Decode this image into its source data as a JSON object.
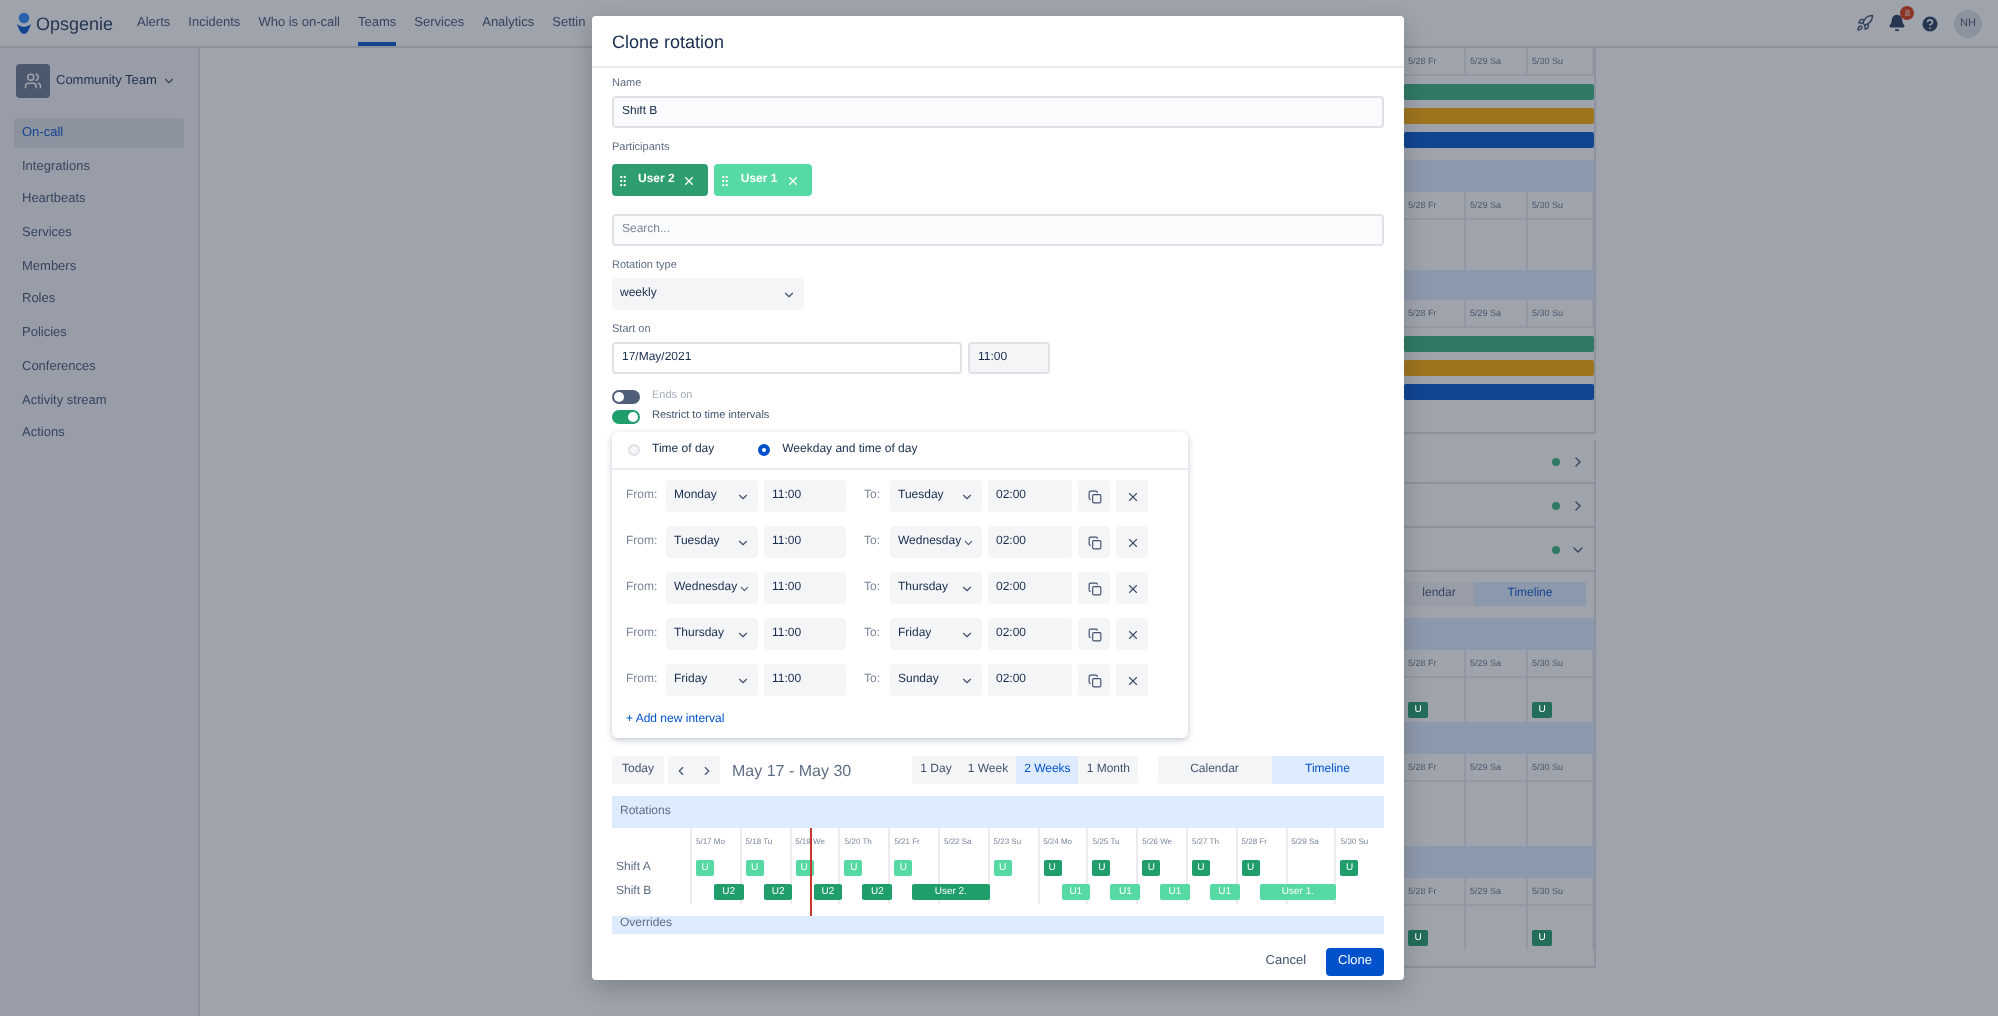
{
  "nav": {
    "logo": "Opsgenie",
    "items": [
      {
        "label": "Alerts",
        "selected": false
      },
      {
        "label": "Incidents",
        "selected": false
      },
      {
        "label": "Who is on-call",
        "selected": false
      },
      {
        "label": "Teams",
        "selected": true
      },
      {
        "label": "Services",
        "selected": false
      },
      {
        "label": "Analytics",
        "selected": false
      },
      {
        "label": "Settin",
        "selected": false
      }
    ],
    "notification_count": "8",
    "avatar": "NH"
  },
  "sidebar": {
    "team": "Community Team",
    "items": [
      {
        "label": "On-call",
        "selected": true
      },
      {
        "label": "Integrations",
        "selected": false
      },
      {
        "label": "Heartbeats",
        "selected": false
      },
      {
        "label": "Services",
        "selected": false
      },
      {
        "label": "Members",
        "selected": false
      },
      {
        "label": "Roles",
        "selected": false
      },
      {
        "label": "Policies",
        "selected": false
      },
      {
        "label": "Conferences",
        "selected": false
      },
      {
        "label": "Activity stream",
        "selected": false
      },
      {
        "label": "Actions",
        "selected": false
      }
    ]
  },
  "schedule_top": {
    "blocks": [
      {
        "days": [
          "5/28 Fr",
          "5/29 Sa",
          "5/30 Su"
        ],
        "bars": [
          {
            "color": "#307965"
          },
          {
            "color": "#9e751f"
          },
          {
            "color": "#124490"
          }
        ]
      },
      {
        "days": [
          "5/28 Fr",
          "5/29 Sa",
          "5/30 Su"
        ]
      },
      {
        "days": [
          "5/28 Fr",
          "5/29 Sa",
          "5/30 Su"
        ],
        "bars": [
          {
            "color": "#307965"
          },
          {
            "color": "#9e751f"
          },
          {
            "color": "#124490"
          }
        ]
      }
    ]
  },
  "schedule_rows": [
    {
      "color": "#307965",
      "expanded": false
    },
    {
      "color": "#307965",
      "expanded": false
    },
    {
      "color": "#307965",
      "expanded": true
    }
  ],
  "schedule_bottom": {
    "tabs": [
      {
        "label": "lendar",
        "selected": false
      },
      {
        "label": "Timeline",
        "selected": true
      }
    ],
    "blocks": [
      {
        "days": [
          "5/28 Fr",
          "5/29 Sa",
          "5/30 Su"
        ],
        "cells": [
          {
            "label": "U",
            "color": "#236d5a"
          },
          null,
          {
            "label": "U",
            "color": "#236d5a"
          }
        ]
      },
      {
        "days": [
          "5/28 Fr",
          "5/29 Sa",
          "5/30 Su"
        ]
      },
      {
        "days": [
          "5/28 Fr",
          "5/29 Sa",
          "5/30 Su"
        ],
        "cells": [
          {
            "label": "U",
            "color": "#236d5a"
          },
          null,
          {
            "label": "U",
            "color": "#236d5a"
          }
        ]
      }
    ]
  },
  "dialog": {
    "title": "Clone rotation",
    "name": {
      "label": "Name",
      "value": "Shift B"
    },
    "participants": {
      "label": "Participants",
      "chips": [
        {
          "label": "User 2",
          "color": "#2e9e6e"
        },
        {
          "label": "User 1",
          "color": "#57d9a3"
        }
      ],
      "search_placeholder": "Search..."
    },
    "rotation_type": {
      "label": "Rotation type",
      "value": "weekly"
    },
    "start_on": {
      "label": "Start on",
      "date": "17/May/2021",
      "time": "11:00"
    },
    "toggles": [
      {
        "label": "Ends on",
        "on": false
      },
      {
        "label": "Restrict to time intervals",
        "on": true
      }
    ],
    "restriction": {
      "options": [
        {
          "label": "Time of day",
          "selected": false
        },
        {
          "label": "Weekday and time of day",
          "selected": true
        }
      ],
      "intervals": [
        {
          "from_label": "From:",
          "from_day": "Monday",
          "from_time": "11:00",
          "to_label": "To:",
          "to_day": "Tuesday",
          "to_time": "02:00"
        },
        {
          "from_label": "From:",
          "from_day": "Tuesday",
          "from_time": "11:00",
          "to_label": "To:",
          "to_day": "Wednesday",
          "to_time": "02:00"
        },
        {
          "from_label": "From:",
          "from_day": "Wednesday",
          "from_time": "11:00",
          "to_label": "To:",
          "to_day": "Thursday",
          "to_time": "02:00"
        },
        {
          "from_label": "From:",
          "from_day": "Thursday",
          "from_time": "11:00",
          "to_label": "To:",
          "to_day": "Friday",
          "to_time": "02:00"
        },
        {
          "from_label": "From:",
          "from_day": "Friday",
          "from_time": "11:00",
          "to_label": "To:",
          "to_day": "Sunday",
          "to_time": "02:00"
        }
      ],
      "add_link": "+ Add new interval"
    },
    "preview": {
      "today": "Today",
      "range": "May 17 - May 30",
      "periods": [
        {
          "label": "1 Day",
          "selected": false
        },
        {
          "label": "1 Week",
          "selected": false
        },
        {
          "label": "2 Weeks",
          "selected": true
        },
        {
          "label": "1 Month",
          "selected": false
        }
      ],
      "views": [
        {
          "label": "Calendar",
          "selected": false
        },
        {
          "label": "Timeline",
          "selected": true
        }
      ],
      "rotations_title": "Rotations",
      "days": [
        {
          "label": "5/17 Mo",
          "today": false
        },
        {
          "label": "5/18 Tu",
          "today": false
        },
        {
          "label": "5/19 We",
          "today": true
        },
        {
          "label": "5/20 Th",
          "today": false
        },
        {
          "label": "5/21 Fr",
          "today": false
        },
        {
          "label": "5/22 Sa",
          "today": false
        },
        {
          "label": "5/23 Su",
          "today": false
        },
        {
          "label": "5/24 Mo",
          "today": false
        },
        {
          "label": "5/25 Tu",
          "today": false
        },
        {
          "label": "5/26 We",
          "today": false
        },
        {
          "label": "5/27 Th",
          "today": false
        },
        {
          "label": "5/28 Fr",
          "today": false
        },
        {
          "label": "5/29 Sa",
          "today": false
        },
        {
          "label": "5/30 Su",
          "today": false
        }
      ],
      "rows": [
        {
          "name": "Shift A",
          "cells": [
            {
              "kind": "badge",
              "label": "U",
              "color": "#57d9a3"
            },
            {
              "kind": "badge",
              "label": "U",
              "color": "#57d9a3"
            },
            {
              "kind": "badge",
              "label": "U",
              "color": "#57d9a3"
            },
            {
              "kind": "badge",
              "label": "U",
              "color": "#57d9a3"
            },
            {
              "kind": "badge",
              "label": "U",
              "color": "#57d9a3"
            },
            null,
            {
              "kind": "badge",
              "label": "U",
              "color": "#57d9a3"
            },
            {
              "kind": "badge",
              "label": "U",
              "color": "#1f9d6b"
            },
            {
              "kind": "badge",
              "label": "U",
              "color": "#1f9d6b"
            },
            {
              "kind": "badge",
              "label": "U",
              "color": "#1f9d6b"
            },
            {
              "kind": "badge",
              "label": "U",
              "color": "#1f9d6b"
            },
            {
              "kind": "badge",
              "label": "U",
              "color": "#1f9d6b"
            },
            null,
            {
              "kind": "badge",
              "label": "U",
              "color": "#1f9d6b"
            }
          ]
        },
        {
          "name": "Shift B",
          "cells": [
            {
              "kind": "short",
              "label": "U2",
              "color": "#1f9d6b"
            },
            {
              "kind": "short",
              "label": "U2",
              "color": "#1f9d6b"
            },
            {
              "kind": "short",
              "label": "U2",
              "color": "#1f9d6b"
            },
            {
              "kind": "short",
              "label": "U2",
              "color": "#1f9d6b"
            },
            {
              "kind": "long",
              "label": "User 2.",
              "color": "#1f9d6b"
            },
            null,
            null,
            {
              "kind": "short",
              "label": "U1",
              "color": "#57d9a3"
            },
            {
              "kind": "short",
              "label": "U1",
              "color": "#57d9a3"
            },
            {
              "kind": "short",
              "label": "U1",
              "color": "#57d9a3"
            },
            {
              "kind": "short",
              "label": "U1",
              "color": "#57d9a3"
            },
            {
              "kind": "long",
              "label": "User 1.",
              "color": "#57d9a3"
            },
            null,
            null
          ]
        }
      ],
      "overrides_title": "Overrides"
    },
    "buttons": {
      "cancel": "Cancel",
      "clone": "Clone"
    }
  }
}
